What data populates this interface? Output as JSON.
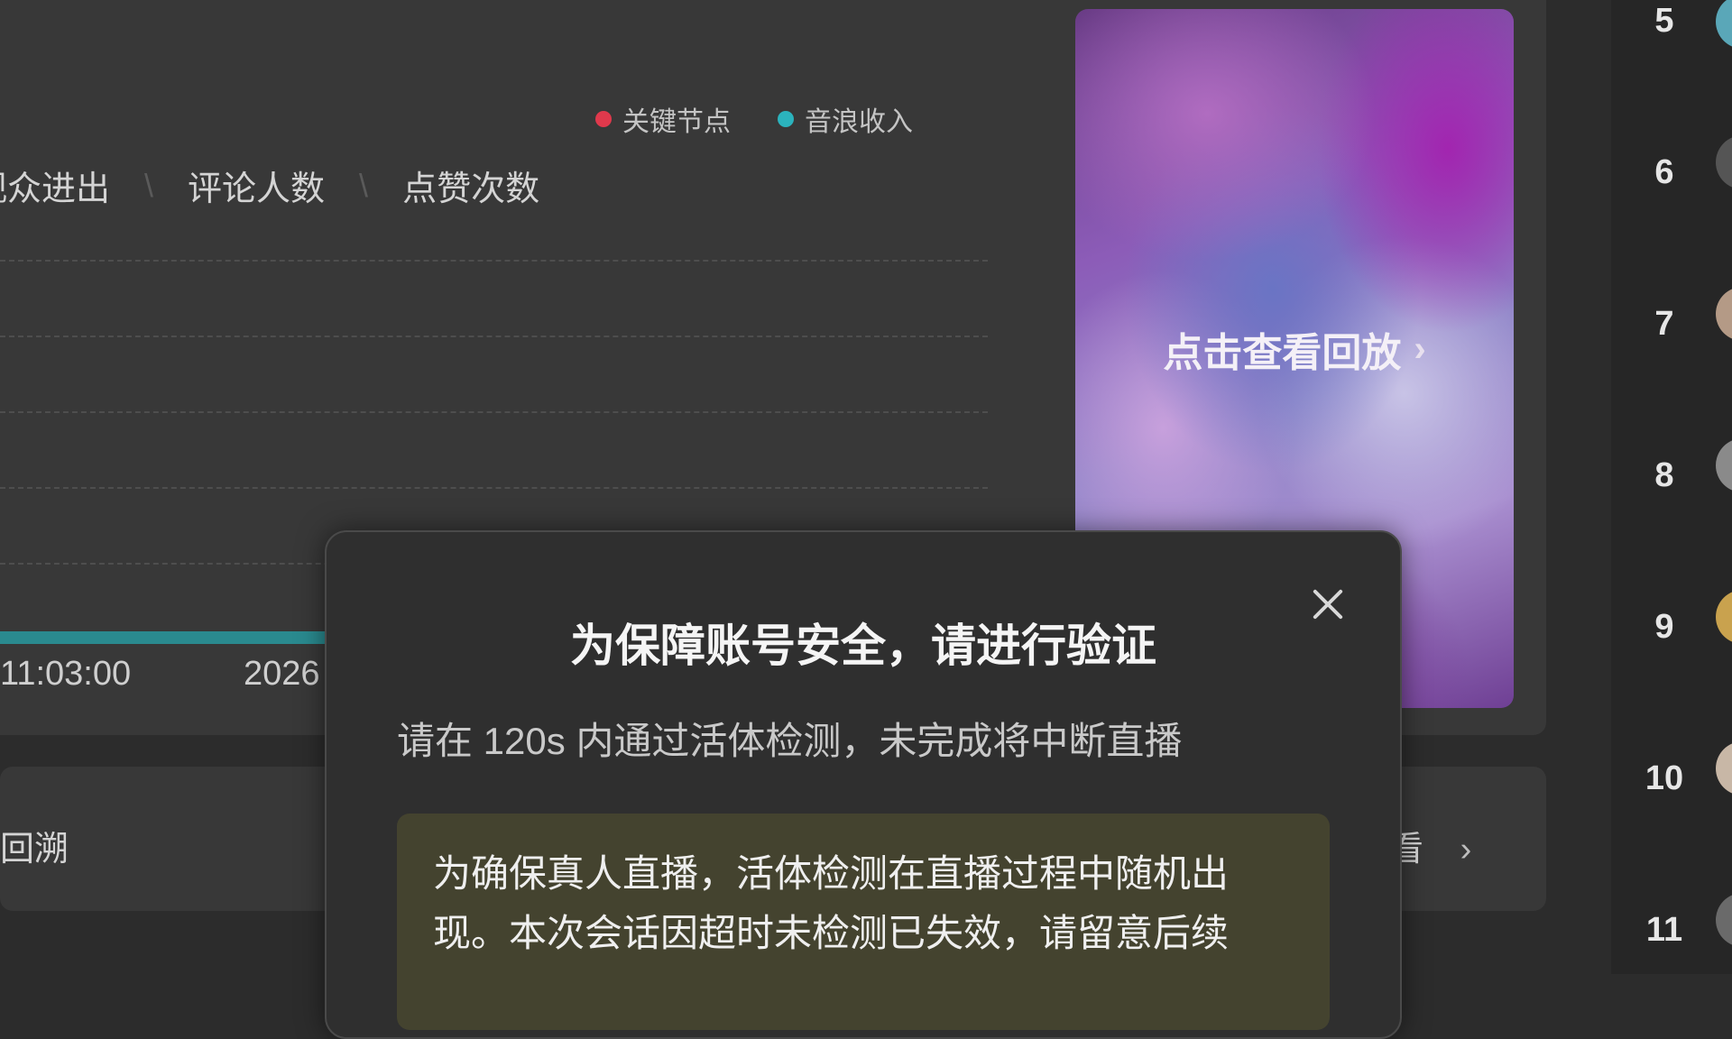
{
  "chart": {
    "legend": [
      {
        "label": "关键节点",
        "color": "#e0394c"
      },
      {
        "label": "音浪收入",
        "color": "#2bb3bd"
      }
    ],
    "metric_tabs": [
      "观众进出",
      "评论人数",
      "点赞次数"
    ],
    "tab_separator": "\\",
    "x_ticks": [
      "11:03:00",
      "2026"
    ]
  },
  "replay": {
    "label": "点击查看回放",
    "chevron": "›"
  },
  "bottom": {
    "left_text": "回溯",
    "right_text": "看",
    "chevron": "›"
  },
  "ranking": {
    "numbers": [
      "5",
      "6",
      "7",
      "8",
      "9",
      "10",
      "11"
    ],
    "avatar_colors": [
      "#5aa7b8",
      "#555555",
      "#b49a86",
      "#8a8a8a",
      "#c9a24e",
      "#c8b7a6",
      "#6a6a6a"
    ]
  },
  "dialog": {
    "title": "为保障账号安全，请进行验证",
    "subtitle": "请在 120s 内通过活体检测，未完成将中断直播",
    "notice_line1": "为确保真人直播，活体检测在直播过程中随机出",
    "notice_line2": "现。本次会话因超时未检测已失效，请留意后续",
    "close_icon": "close-icon"
  }
}
